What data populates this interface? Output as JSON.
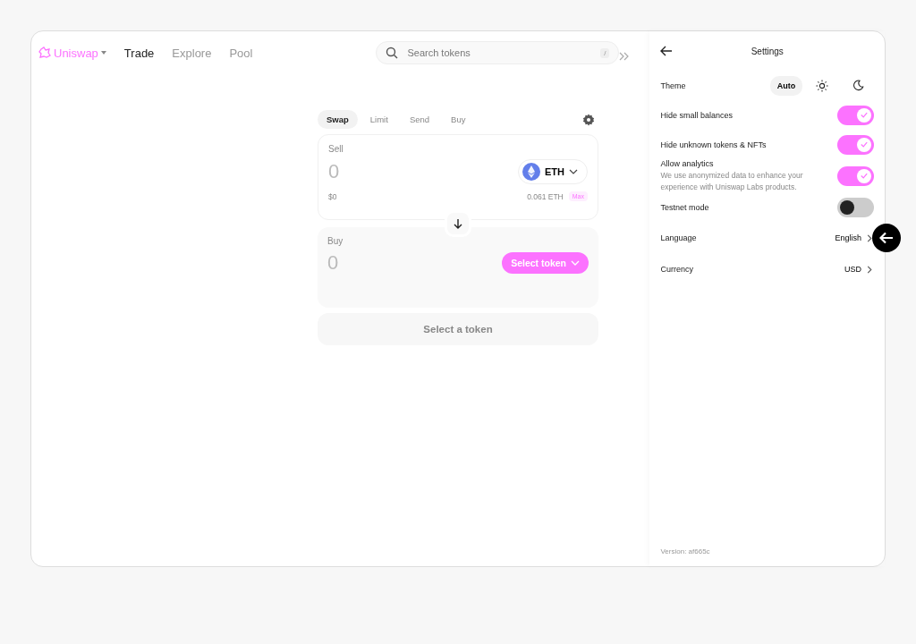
{
  "header": {
    "brand": "Uniswap",
    "nav": [
      {
        "label": "Trade",
        "selected": true
      },
      {
        "label": "Explore",
        "selected": false
      },
      {
        "label": "Pool",
        "selected": false
      }
    ],
    "search": {
      "placeholder": "Search tokens",
      "shortcut": "/"
    }
  },
  "swap": {
    "tabs": [
      {
        "label": "Swap",
        "selected": true
      },
      {
        "label": "Limit",
        "selected": false
      },
      {
        "label": "Send",
        "selected": false
      },
      {
        "label": "Buy",
        "selected": false
      }
    ],
    "sell": {
      "label": "Sell",
      "amount": "0",
      "token": "ETH",
      "usd": "$0",
      "balance": "0.061 ETH",
      "max": "Max"
    },
    "buy": {
      "label": "Buy",
      "amount": "0",
      "select": "Select token"
    },
    "action": "Select a token"
  },
  "settings": {
    "title": "Settings",
    "theme": {
      "label": "Theme",
      "options": [
        {
          "kind": "text",
          "label": "Auto",
          "selected": true
        },
        {
          "kind": "sun",
          "selected": false
        },
        {
          "kind": "moon",
          "selected": false
        }
      ]
    },
    "items": [
      {
        "kind": "toggle",
        "label": "Hide small balances",
        "on": true
      },
      {
        "kind": "toggle",
        "label": "Hide unknown tokens & NFTs",
        "on": true
      },
      {
        "kind": "toggle",
        "label": "Allow analytics",
        "description": "We use anonymized data to enhance your experience with Uniswap Labs products.",
        "on": true
      },
      {
        "kind": "toggle",
        "label": "Testnet mode",
        "on": false
      },
      {
        "kind": "link",
        "label": "Language",
        "value": "English",
        "pointer": true
      },
      {
        "kind": "link",
        "label": "Currency",
        "value": "USD",
        "pointer": false
      }
    ],
    "version": "Version: af665c"
  }
}
